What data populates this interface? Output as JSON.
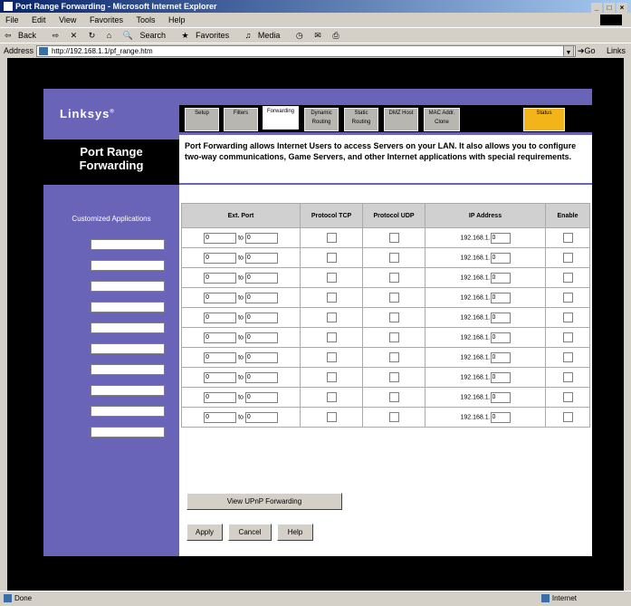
{
  "window": {
    "title": "Port Range Forwarding - Microsoft Internet Explorer"
  },
  "menu": [
    "File",
    "Edit",
    "View",
    "Favorites",
    "Tools",
    "Help"
  ],
  "toolbar": {
    "back": "Back",
    "search": "Search",
    "favorites": "Favorites",
    "media": "Media"
  },
  "address": {
    "label": "Address",
    "url": "http://192.168.1.1/pf_range.htm",
    "go": "Go",
    "links": "Links"
  },
  "brand": {
    "logo": "Linksys"
  },
  "tabs": [
    "Setup",
    "Filters",
    "Forwarding",
    "Dynamic Routing",
    "Static Routing",
    "DMZ Host",
    "MAC Addr. Clone",
    "Status"
  ],
  "page": {
    "title_line1": "Port Range",
    "title_line2": "Forwarding",
    "intro": "Port Forwarding allows Internet Users to access Servers on your LAN. It also allows you to configure two-way communications, Game Servers, and other Internet applications with special requirements."
  },
  "sidebar": {
    "header": "Customized Applications"
  },
  "table": {
    "headers": {
      "ext_port": "Ext. Port",
      "tcp": "Protocol TCP",
      "udp": "Protocol UDP",
      "ip": "IP Address",
      "enable": "Enable"
    },
    "to_label": "to",
    "ip_prefix": "192.168.1.",
    "rows": [
      {
        "start": "0",
        "end": "0",
        "last": "0"
      },
      {
        "start": "0",
        "end": "0",
        "last": "0"
      },
      {
        "start": "0",
        "end": "0",
        "last": "0"
      },
      {
        "start": "0",
        "end": "0",
        "last": "0"
      },
      {
        "start": "0",
        "end": "0",
        "last": "0"
      },
      {
        "start": "0",
        "end": "0",
        "last": "0"
      },
      {
        "start": "0",
        "end": "0",
        "last": "0"
      },
      {
        "start": "0",
        "end": "0",
        "last": "0"
      },
      {
        "start": "0",
        "end": "0",
        "last": "0"
      },
      {
        "start": "0",
        "end": "0",
        "last": "0"
      }
    ]
  },
  "buttons": {
    "upnp": "View UPnP Forwarding",
    "apply": "Apply",
    "cancel": "Cancel",
    "help": "Help"
  },
  "status": {
    "left": "Done",
    "right": "Internet"
  }
}
